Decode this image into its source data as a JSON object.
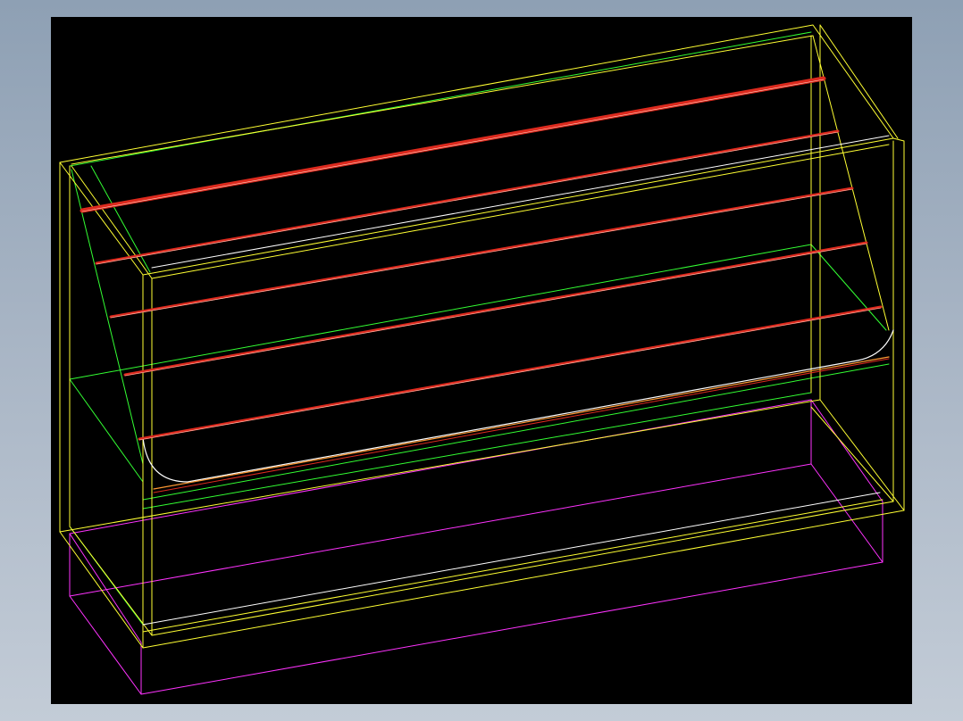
{
  "viewport": {
    "background": "#000000"
  },
  "palette": {
    "frame": "#ffff33",
    "edge": "#33ff33",
    "base": "#ff33ff",
    "rod": "#dd2a1e",
    "rod_highlight": "#ffd0c0",
    "curve": "#ffffff",
    "lip": "#ff9933"
  },
  "model": {
    "rod_count": 6
  }
}
